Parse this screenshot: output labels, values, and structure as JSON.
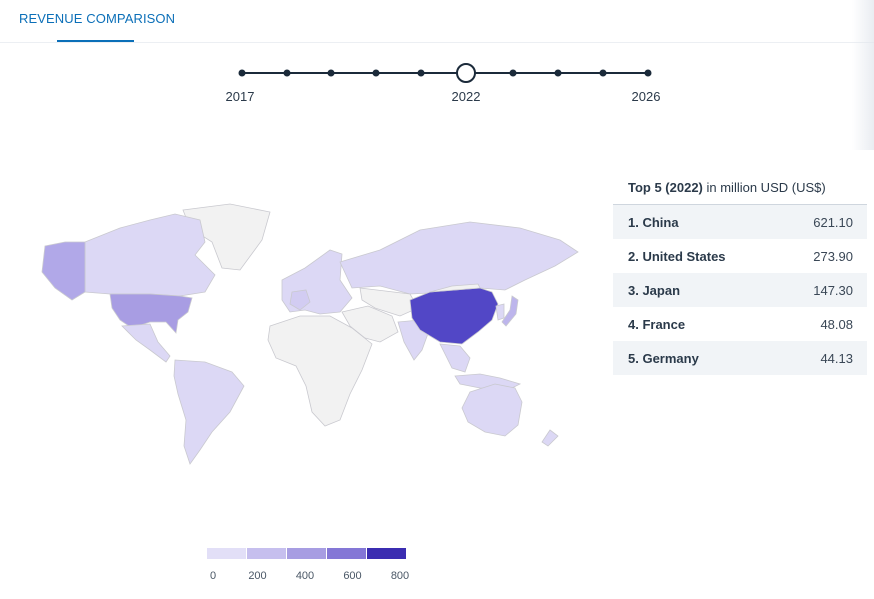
{
  "tab": {
    "label": "REVENUE COMPARISON"
  },
  "timeline": {
    "labels": [
      {
        "year": "2017"
      },
      {
        "year": "2022"
      },
      {
        "year": "2026"
      }
    ],
    "selected_year": "2022"
  },
  "panel": {
    "title_bold": "Top 5 (2022)",
    "title_rest": " in million USD (US$)",
    "rows": [
      {
        "country": "1. China",
        "value": "621.10"
      },
      {
        "country": "2. United States",
        "value": "273.90"
      },
      {
        "country": "3. Japan",
        "value": "147.30"
      },
      {
        "country": "4. France",
        "value": "48.08"
      },
      {
        "country": "5. Germany",
        "value": "44.13"
      }
    ]
  },
  "legend": {
    "ticks": [
      "0",
      "200",
      "400",
      "600",
      "800"
    ],
    "colors": [
      "#e2dff7",
      "#c6bfee",
      "#a79de2",
      "#8477d6",
      "#3b2db1"
    ]
  },
  "colors": {
    "accent": "#0b6fb8",
    "no_data": "#f2f2f2",
    "low": "#dcd8f5",
    "mid": "#a89de3",
    "high": "#5247c6"
  },
  "chart_data": {
    "type": "choropleth",
    "title": "",
    "year": "2022",
    "unit": "million USD (US$)",
    "values": [
      {
        "country": "China",
        "value": 621.1
      },
      {
        "country": "United States",
        "value": 273.9
      },
      {
        "country": "Japan",
        "value": 147.3
      },
      {
        "country": "France",
        "value": 48.08
      },
      {
        "country": "Germany",
        "value": 44.13
      }
    ],
    "scale_range": [
      0,
      800
    ]
  }
}
